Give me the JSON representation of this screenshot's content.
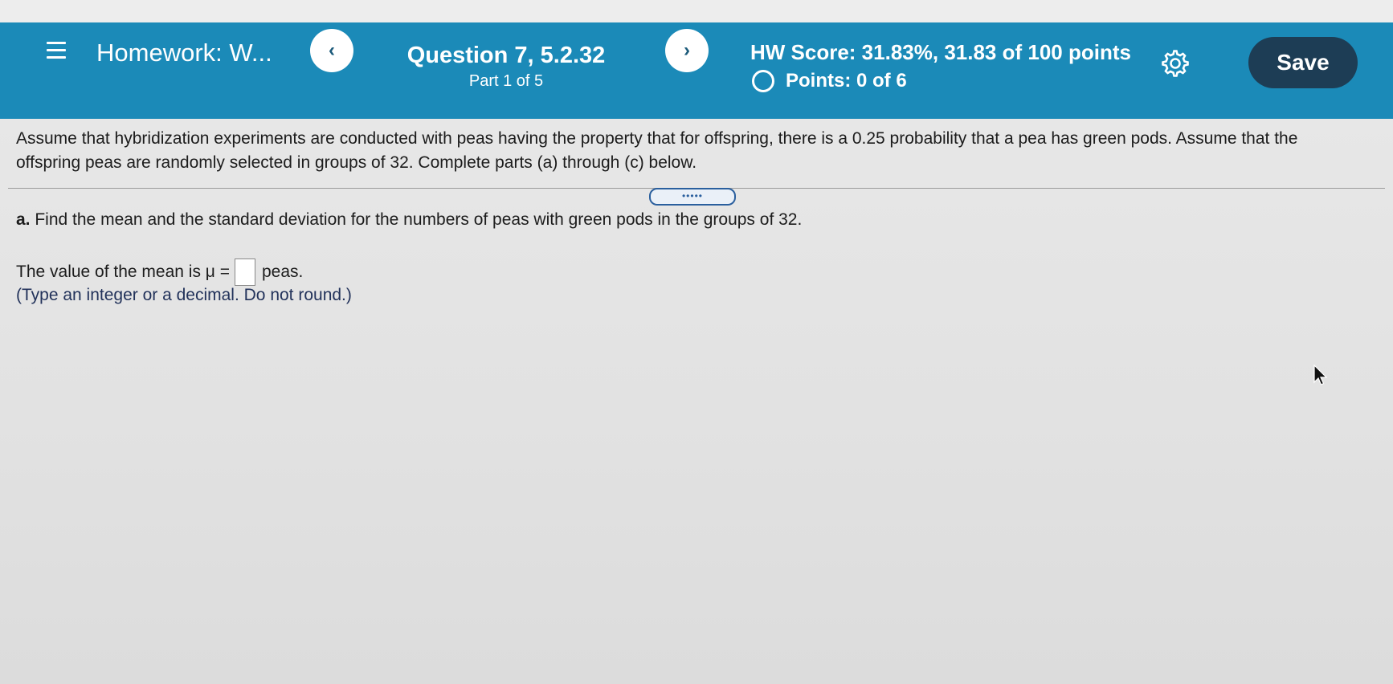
{
  "header": {
    "menu_icon": "hamburger-menu-icon",
    "title": "Homework: W...",
    "prev_label": "‹",
    "next_label": "›",
    "question_title": "Question 7, 5.2.32",
    "question_part": "Part 1 of 5",
    "hw_score": "HW Score: 31.83%, 31.83 of 100 points",
    "points": "Points: 0 of 6",
    "settings_icon": "gear-icon",
    "save_label": "Save",
    "colors": {
      "header_bg": "#1b8ab8",
      "save_bg": "#1d3d55"
    }
  },
  "question": {
    "intro": "Assume that hybridization experiments are conducted with peas having the property that for offspring, there is a 0.25 probability that a pea has green pods. Assume that the offspring peas are randomly selected in groups of 32. Complete parts (a) through (c) below.",
    "collapse_handle": "•••••",
    "part_a_letter": "a.",
    "part_a_text": "Find the mean and the standard deviation for the numbers of peas with green pods in the groups of 32.",
    "answer_prefix": "The value of the mean is μ =",
    "answer_value": "",
    "answer_suffix": "peas.",
    "hint": "(Type an integer or a decimal. Do not round.)"
  }
}
